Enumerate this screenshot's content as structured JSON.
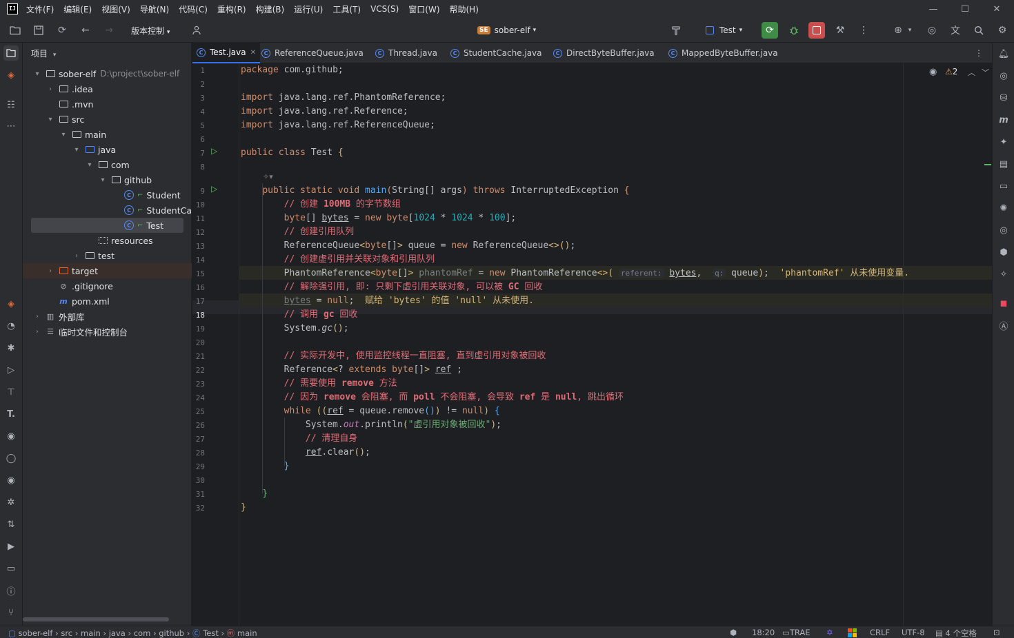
{
  "menu": [
    "文件(F)",
    "编辑(E)",
    "视图(V)",
    "导航(N)",
    "代码(C)",
    "重构(R)",
    "构建(B)",
    "运行(U)",
    "工具(T)",
    "VCS(S)",
    "窗口(W)",
    "帮助(H)"
  ],
  "app": {
    "logo": "IJ"
  },
  "toolbar": {
    "vcs": "版本控制",
    "project_badge": "SE",
    "project": "sober-elf",
    "run_config": "Test",
    "colors": {
      "run": "#3e8c46",
      "stop": "#c94f4f"
    }
  },
  "project_panel": {
    "title": "项目"
  },
  "tree": [
    {
      "label": "sober-elf",
      "path": "D:\\project\\sober-elf",
      "indent": 0,
      "arrow": "▾",
      "kind": "module"
    },
    {
      "label": ".idea",
      "indent": 1,
      "arrow": "›",
      "kind": "folder"
    },
    {
      "label": ".mvn",
      "indent": 1,
      "arrow": "",
      "kind": "folder"
    },
    {
      "label": "src",
      "indent": 1,
      "arrow": "▾",
      "kind": "folder"
    },
    {
      "label": "main",
      "indent": 2,
      "arrow": "▾",
      "kind": "folder"
    },
    {
      "label": "java",
      "indent": 3,
      "arrow": "▾",
      "kind": "src-folder"
    },
    {
      "label": "com",
      "indent": 4,
      "arrow": "▾",
      "kind": "package"
    },
    {
      "label": "github",
      "indent": 5,
      "arrow": "▾",
      "kind": "package"
    },
    {
      "label": "Student",
      "indent": 6,
      "arrow": "",
      "kind": "class"
    },
    {
      "label": "StudentCa",
      "indent": 6,
      "arrow": "",
      "kind": "class"
    },
    {
      "label": "Test",
      "indent": 6,
      "arrow": "",
      "kind": "class",
      "selected": true
    },
    {
      "label": "resources",
      "indent": 4,
      "arrow": "",
      "kind": "res-folder"
    },
    {
      "label": "test",
      "indent": 3,
      "arrow": "›",
      "kind": "folder"
    },
    {
      "label": "target",
      "indent": 1,
      "arrow": "›",
      "kind": "excluded",
      "highlight": true
    },
    {
      "label": ".gitignore",
      "indent": 1,
      "arrow": "",
      "kind": "ignore"
    },
    {
      "label": "pom.xml",
      "indent": 1,
      "arrow": "",
      "kind": "maven"
    },
    {
      "label": "外部库",
      "indent": 0,
      "arrow": "›",
      "kind": "lib"
    },
    {
      "label": "临时文件和控制台",
      "indent": 0,
      "arrow": "›",
      "kind": "scratch"
    }
  ],
  "tabs": [
    "Test.java",
    "ReferenceQueue.java",
    "Thread.java",
    "StudentCache.java",
    "DirectByteBuffer.java",
    "MappedByteBuffer.java"
  ],
  "editor": {
    "warnings": "2",
    "line_numbers": [
      "1",
      "2",
      "3",
      "4",
      "5",
      "6",
      "7",
      "8",
      "9",
      "10",
      "11",
      "12",
      "13",
      "14",
      "15",
      "16",
      "17",
      "18",
      "19",
      "20",
      "21",
      "22",
      "23",
      "24",
      "25",
      "26",
      "27",
      "28",
      "29",
      "30",
      "31",
      "32"
    ],
    "inlay": {
      "referent": "referent:",
      "q": "q:"
    },
    "line15_warning": "'phantomRef' 从未使用变量.",
    "line17_warning": "赋给 'bytes' 的值 'null' 从未使用."
  },
  "status": {
    "breadcrumb": [
      "sober-elf",
      "src",
      "main",
      "java",
      "com",
      "github",
      "Test",
      "main"
    ],
    "position": "18:20",
    "trae": "TRAE",
    "line_sep": "CRLF",
    "encoding": "UTF-8",
    "indent": "4 个空格"
  }
}
